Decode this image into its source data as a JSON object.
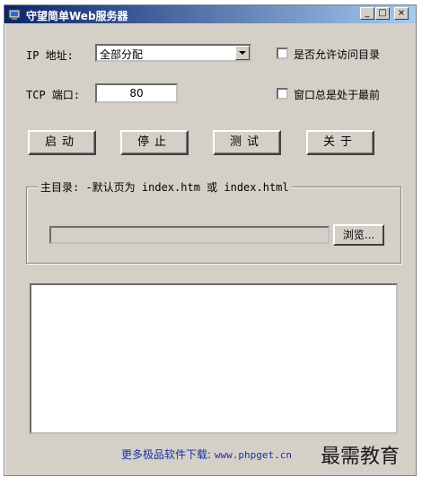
{
  "window": {
    "title": "守望简单Web服务器",
    "controls": {
      "minimize": "_",
      "maximize": "□",
      "close": "×"
    }
  },
  "ip": {
    "label": "IP 地址:",
    "value": "全部分配"
  },
  "options": {
    "allow_dir": "是否允许访问目录",
    "always_on_top": "窗口总是处于最前"
  },
  "tcp": {
    "label": "TCP 端口:",
    "value": "80"
  },
  "buttons": {
    "start": "启动",
    "stop": "停止",
    "test": "测试",
    "about": "关于"
  },
  "root_dir": {
    "title": "主目录: -默认页为 index.htm 或 index.html",
    "path": "",
    "browse": "浏览..."
  },
  "footer": {
    "text": "更多极品软件下载:",
    "url": "www.phpget.cn"
  },
  "watermark": "最需教育"
}
